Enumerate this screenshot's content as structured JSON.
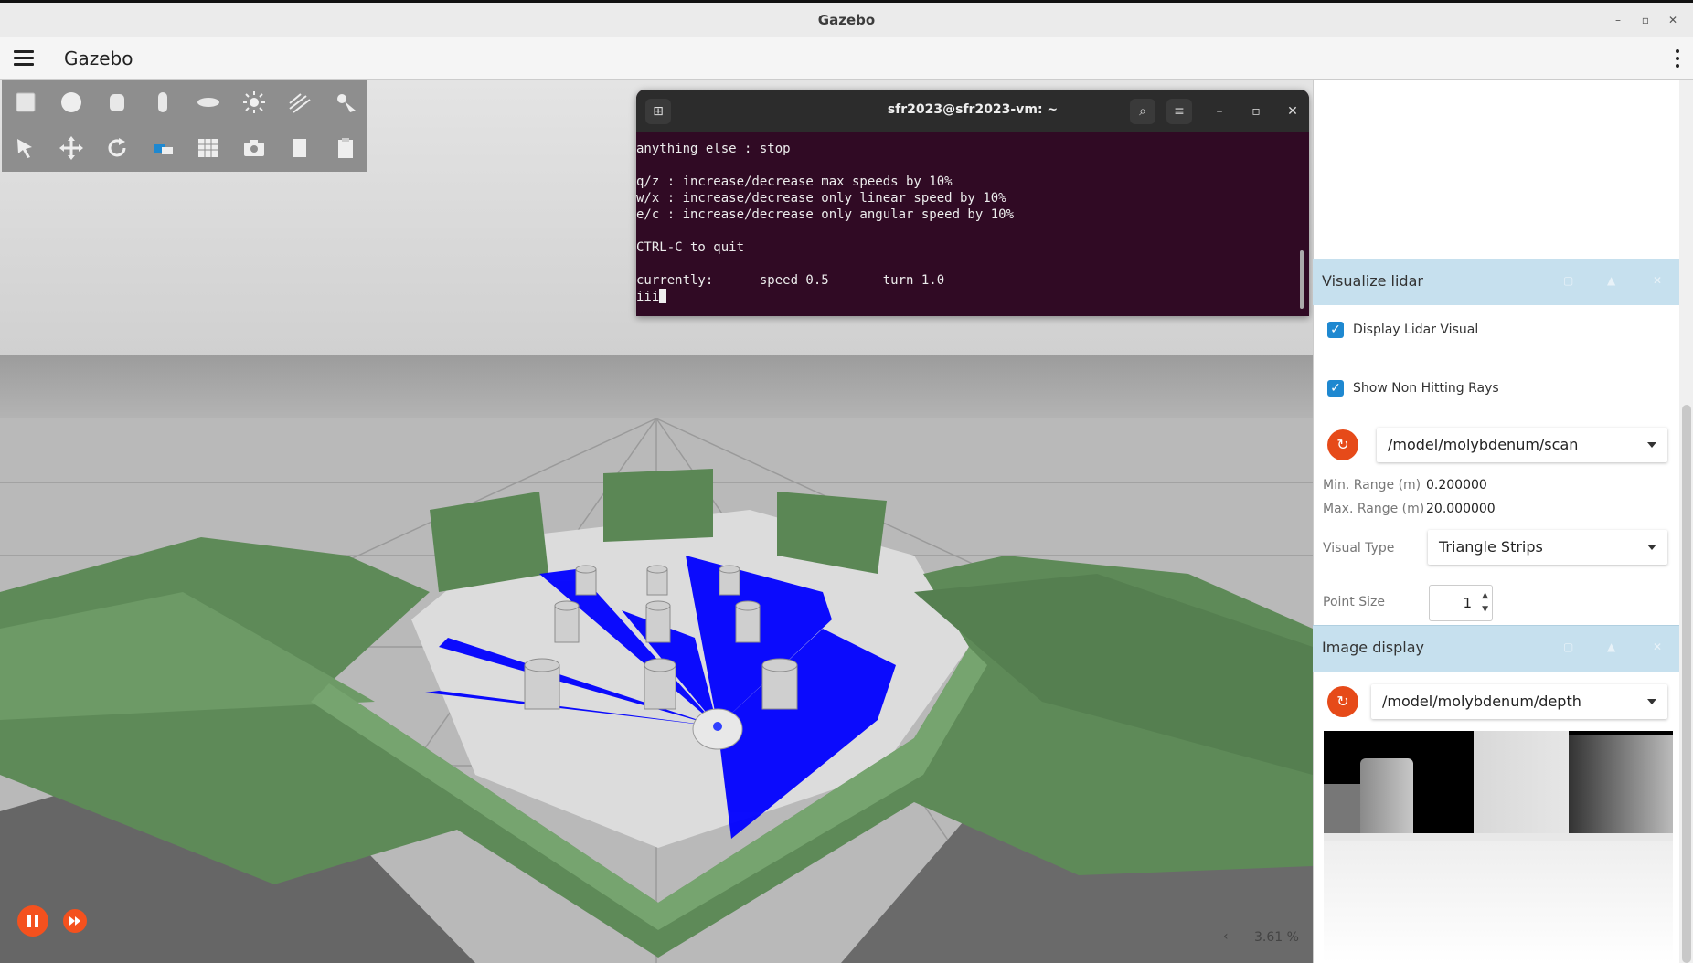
{
  "window": {
    "title": "Gazebo",
    "controls": [
      "–",
      "▫",
      "✕"
    ]
  },
  "appbar": {
    "title": "Gazebo"
  },
  "toolbar": {
    "row1": [
      "box-icon",
      "sphere-icon",
      "cylinder-icon",
      "capsule-icon",
      "ellipsoid-icon",
      "point-light-icon",
      "directional-light-icon",
      "spot-light-icon"
    ],
    "row2": [
      "select-icon",
      "translate-icon",
      "rotate-icon",
      "transform-control-icon",
      "grid-snap-icon",
      "screenshot-icon",
      "copy-icon",
      "paste-icon"
    ]
  },
  "terminal": {
    "title": "sfr2023@sfr2023-vm: ~",
    "lines": [
      "anything else : stop",
      "",
      "q/z : increase/decrease max speeds by 10%",
      "w/x : increase/decrease only linear speed by 10%",
      "e/c : increase/decrease only angular speed by 10%",
      "",
      "CTRL-C to quit",
      "",
      "currently:      speed 0.5       turn 1.0"
    ],
    "input": "iii"
  },
  "lidar_panel": {
    "title": "Visualize lidar",
    "display_lidar_label": "Display Lidar Visual",
    "display_lidar_checked": true,
    "non_hitting_label": "Show Non Hitting Rays",
    "non_hitting_checked": true,
    "topic": "/model/molybdenum/scan",
    "min_range_label": "Min. Range (m)",
    "min_range_value": "0.200000",
    "max_range_label": "Max. Range (m)",
    "max_range_value": "20.000000",
    "visual_type_label": "Visual Type",
    "visual_type_value": "Triangle Strips",
    "point_size_label": "Point Size",
    "point_size_value": "1"
  },
  "image_panel": {
    "title": "Image display",
    "topic": "/model/molybdenum/depth"
  },
  "status": {
    "rtf": "3.61 %"
  },
  "colors": {
    "accent": "#f4511e",
    "panel_header": "#c6e0ee",
    "checkbox": "#1e88d0",
    "terminal_bg": "#300a24",
    "wall_green": "#5e8a58",
    "lidar_blue": "#0000ff"
  }
}
